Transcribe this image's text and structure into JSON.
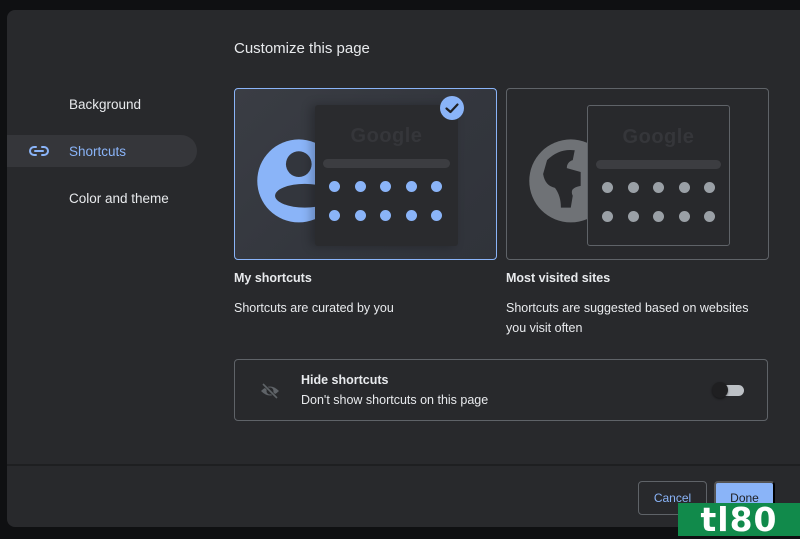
{
  "dialog": {
    "title": "Customize this page"
  },
  "sidebar": {
    "items": [
      {
        "label": "Background",
        "icon": "",
        "active": false
      },
      {
        "label": "Shortcuts",
        "icon": "link-icon",
        "active": true
      },
      {
        "label": "Color and theme",
        "icon": "",
        "active": false
      }
    ]
  },
  "options": [
    {
      "title": "My shortcuts",
      "description": "Shortcuts are curated by you",
      "selected": true,
      "illustration": {
        "icon": "person-icon",
        "preview_text": "Google",
        "accent": "#8ab4f8"
      }
    },
    {
      "title": "Most visited sites",
      "description": "Shortcuts are suggested based on websites you visit often",
      "selected": false,
      "illustration": {
        "icon": "globe-icon",
        "preview_text": "Google",
        "accent": "#9aa0a6"
      }
    }
  ],
  "hide_shortcuts": {
    "icon": "eye-off-icon",
    "title": "Hide shortcuts",
    "description": "Don't show shortcuts on this page",
    "enabled": false
  },
  "footer": {
    "cancel_label": "Cancel",
    "done_label": "Done"
  },
  "watermark": "tl80",
  "colors": {
    "accent": "#8ab4f8",
    "dialog_bg": "#28292c",
    "muted": "#9aa0a6"
  }
}
